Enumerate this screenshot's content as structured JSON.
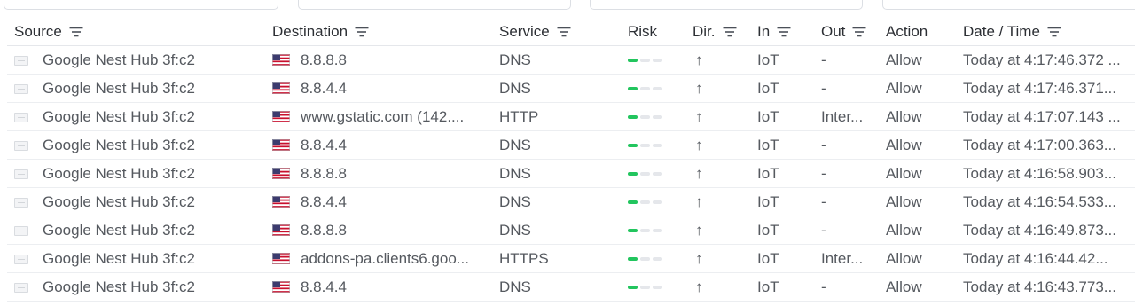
{
  "table": {
    "columns": [
      {
        "id": "source",
        "label": "Source",
        "sortable": true
      },
      {
        "id": "destination",
        "label": "Destination",
        "sortable": true
      },
      {
        "id": "service",
        "label": "Service",
        "sortable": true
      },
      {
        "id": "risk",
        "label": "Risk",
        "sortable": false
      },
      {
        "id": "dir",
        "label": "Dir.",
        "sortable": true
      },
      {
        "id": "in",
        "label": "In",
        "sortable": true
      },
      {
        "id": "out",
        "label": "Out",
        "sortable": true
      },
      {
        "id": "action",
        "label": "Action",
        "sortable": false
      },
      {
        "id": "datetime",
        "label": "Date / Time",
        "sortable": true
      }
    ],
    "rows": [
      {
        "source": "Google Nest Hub 3f:c2",
        "destination": "8.8.8.8",
        "service": "DNS",
        "risk_level": 1,
        "risk_max": 3,
        "dir": "↑",
        "in": "IoT",
        "out": "-",
        "action": "Allow",
        "datetime": "Today at 4:17:46.372 ..."
      },
      {
        "source": "Google Nest Hub 3f:c2",
        "destination": "8.8.4.4",
        "service": "DNS",
        "risk_level": 1,
        "risk_max": 3,
        "dir": "↑",
        "in": "IoT",
        "out": "-",
        "action": "Allow",
        "datetime": "Today at 4:17:46.371..."
      },
      {
        "source": "Google Nest Hub 3f:c2",
        "destination": "www.gstatic.com (142....",
        "service": "HTTP",
        "risk_level": 1,
        "risk_max": 3,
        "dir": "↑",
        "in": "IoT",
        "out": "Inter...",
        "action": "Allow",
        "datetime": "Today at 4:17:07.143 ..."
      },
      {
        "source": "Google Nest Hub 3f:c2",
        "destination": "8.8.4.4",
        "service": "DNS",
        "risk_level": 1,
        "risk_max": 3,
        "dir": "↑",
        "in": "IoT",
        "out": "-",
        "action": "Allow",
        "datetime": "Today at 4:17:00.363..."
      },
      {
        "source": "Google Nest Hub 3f:c2",
        "destination": "8.8.8.8",
        "service": "DNS",
        "risk_level": 1,
        "risk_max": 3,
        "dir": "↑",
        "in": "IoT",
        "out": "-",
        "action": "Allow",
        "datetime": "Today at 4:16:58.903..."
      },
      {
        "source": "Google Nest Hub 3f:c2",
        "destination": "8.8.4.4",
        "service": "DNS",
        "risk_level": 1,
        "risk_max": 3,
        "dir": "↑",
        "in": "IoT",
        "out": "-",
        "action": "Allow",
        "datetime": "Today at 4:16:54.533..."
      },
      {
        "source": "Google Nest Hub 3f:c2",
        "destination": "8.8.8.8",
        "service": "DNS",
        "risk_level": 1,
        "risk_max": 3,
        "dir": "↑",
        "in": "IoT",
        "out": "-",
        "action": "Allow",
        "datetime": "Today at 4:16:49.873..."
      },
      {
        "source": "Google Nest Hub 3f:c2",
        "destination": "addons-pa.clients6.goo...",
        "service": "HTTPS",
        "risk_level": 1,
        "risk_max": 3,
        "dir": "↑",
        "in": "IoT",
        "out": "Inter...",
        "action": "Allow",
        "datetime": "Today at 4:16:44.42..."
      },
      {
        "source": "Google Nest Hub 3f:c2",
        "destination": "8.8.4.4",
        "service": "DNS",
        "risk_level": 1,
        "risk_max": 3,
        "dir": "↑",
        "in": "IoT",
        "out": "-",
        "action": "Allow",
        "datetime": "Today at 4:16:43.773..."
      }
    ]
  },
  "icons": {
    "device": "device-icon",
    "flag": "us-flag-icon",
    "sort": "filter-lines-icon"
  },
  "colors": {
    "risk_low": "#22c55e",
    "risk_empty": "#e5e7eb",
    "border": "#e5e7eb"
  }
}
